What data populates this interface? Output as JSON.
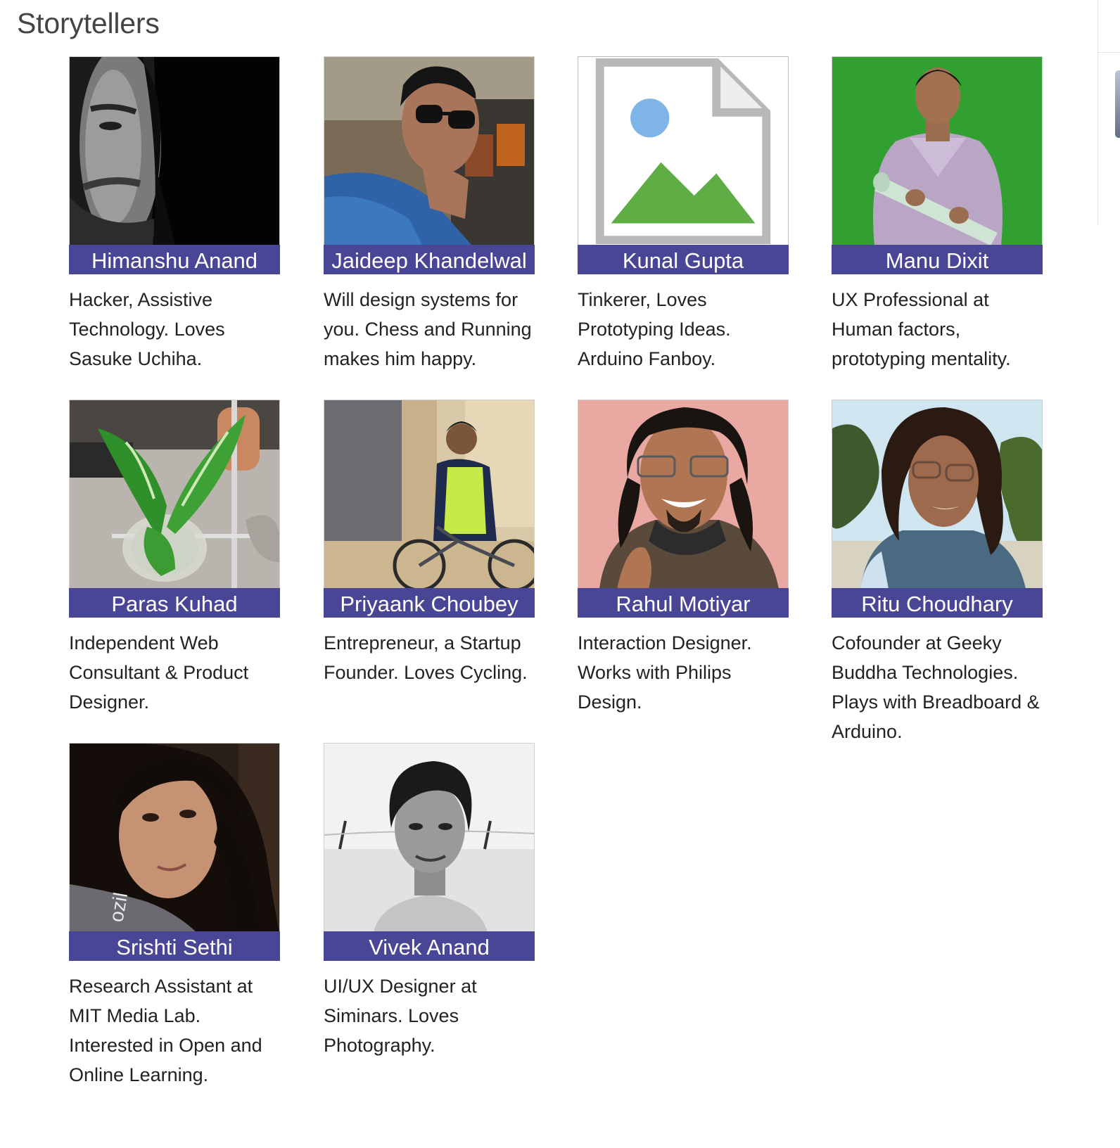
{
  "page": {
    "title": "Storytellers"
  },
  "storytellers": [
    {
      "name": "Himanshu Anand",
      "bio": "Hacker, Assistive Technology. Loves Sasuke Uchiha.",
      "photo": "portrait-dark-background"
    },
    {
      "name": "Jaideep Khandelwal",
      "bio": "Will design systems for you. Chess and Running makes him happy.",
      "photo": "portrait-sunglasses-in-car"
    },
    {
      "name": "Kunal Gupta",
      "bio": "Tinkerer, Loves Prototyping Ideas. Arduino Fanboy.",
      "photo": "broken-image"
    },
    {
      "name": "Manu Dixit",
      "bio": "UX Professional at Human factors, prototyping mentality.",
      "photo": "portrait-green-screen"
    },
    {
      "name": "Paras Kuhad",
      "bio": "Independent Web Consultant & Product Designer.",
      "photo": "plant-in-glass-bowl"
    },
    {
      "name": "Priyaank Choubey",
      "bio": "Entrepreneur, a Startup Founder. Loves Cycling.",
      "photo": "person-with-bicycle"
    },
    {
      "name": "Rahul Motiyar",
      "bio": "Interaction Designer. Works with Philips Design.",
      "photo": "portrait-smiling-glasses"
    },
    {
      "name": "Ritu Choudhary",
      "bio": "Cofounder at Geeky Buddha Technologies. Plays with Breadboard & Arduino.",
      "photo": "portrait-outdoors-trees"
    },
    {
      "name": "Srishti Sethi",
      "bio": "Research Assistant at MIT Media Lab. Interested in Open and Online Learning.",
      "photo": "portrait-dark-room"
    },
    {
      "name": "Vivek Anand",
      "bio": "UI/UX Designer at Siminars. Loves Photography.",
      "photo": "portrait-black-and-white"
    }
  ],
  "colors": {
    "name_bar": "#4a4696",
    "name_text": "#ffffff",
    "heading_text": "#444444",
    "body_text": "#222222"
  }
}
